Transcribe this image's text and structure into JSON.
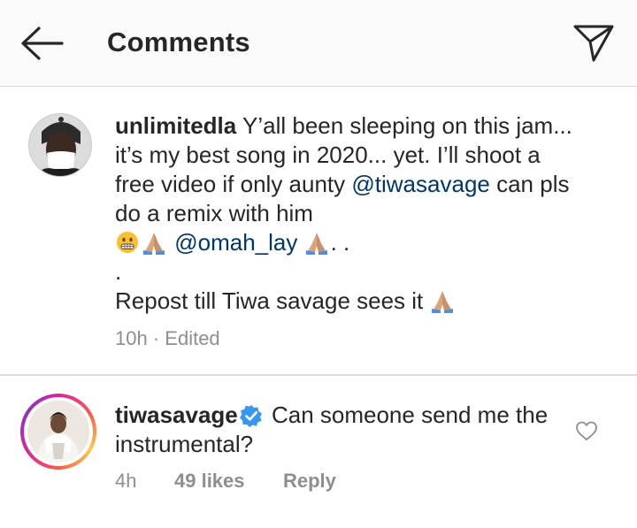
{
  "header": {
    "title": "Comments",
    "back_icon": "arrow-left-icon",
    "send_icon": "paper-plane-icon"
  },
  "comments": [
    {
      "username": "unlimitedla",
      "text_part1": " Y’all been sleeping on this jam... it’s my best song in 2020... yet. I’ll shoot a free video if only aunty ",
      "mention1": "@tiwasavage",
      "text_part2": " can pls do a remix with him",
      "mention2": "@omah_lay",
      "text_part3": ". .",
      "dot_line": ".",
      "last_line": "Repost till Tiwa savage sees it",
      "time": "10h",
      "separator": " · ",
      "edited": "Edited",
      "emojis": [
        "grimacing-face-emoji",
        "folded-hands-emoji"
      ]
    },
    {
      "username": "tiwasavage",
      "verified": true,
      "text": " Can someone send me the instrumental?",
      "time": "4h",
      "likes": "49 likes",
      "reply": "Reply",
      "like_icon": "heart-outline-icon"
    }
  ],
  "colors": {
    "mention": "#00376b",
    "meta": "#8e8e8e",
    "verified": "#3897f0",
    "divider": "#dbdbdb"
  }
}
